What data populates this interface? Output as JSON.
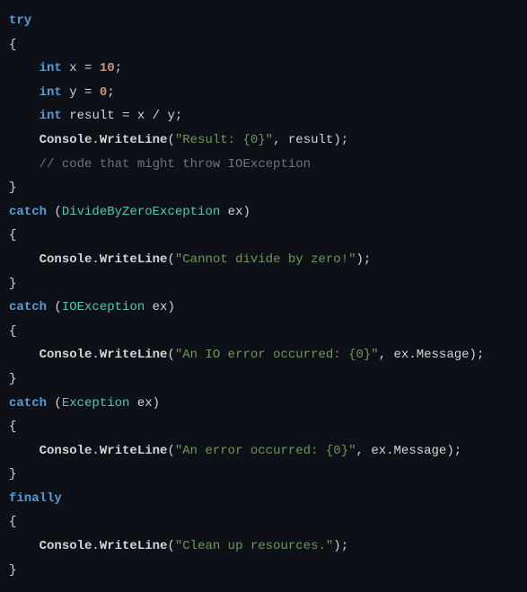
{
  "code": {
    "try": "try",
    "brace_open": "{",
    "brace_close": "}",
    "indent": "    ",
    "int1": "int",
    "x": "x",
    "eq": "=",
    "ten": "10",
    "semi": ";",
    "int2": "int",
    "y": "y",
    "zero": "0",
    "int3": "int",
    "result": "result",
    "xdivY": "x / y",
    "console": "Console",
    "writeline": "WriteLine",
    "openp": "(",
    "closep": ")",
    "str_result": "\"Result: {0}\"",
    "comma": ",",
    "resultArg": "result",
    "comment": "// code that might throw IOException",
    "catch1": "catch",
    "divex": "DivideByZeroException",
    "ex": "ex",
    "str_div": "\"Cannot divide by zero!\"",
    "catch2": "catch",
    "ioex": "IOException",
    "str_io": "\"An IO error occurred: {0}\"",
    "exmsg": "ex.Message",
    "catch3": "catch",
    "exc": "Exception",
    "str_err": "\"An error occurred: {0}\"",
    "finally": "finally",
    "str_clean": "\"Clean up resources.\""
  }
}
